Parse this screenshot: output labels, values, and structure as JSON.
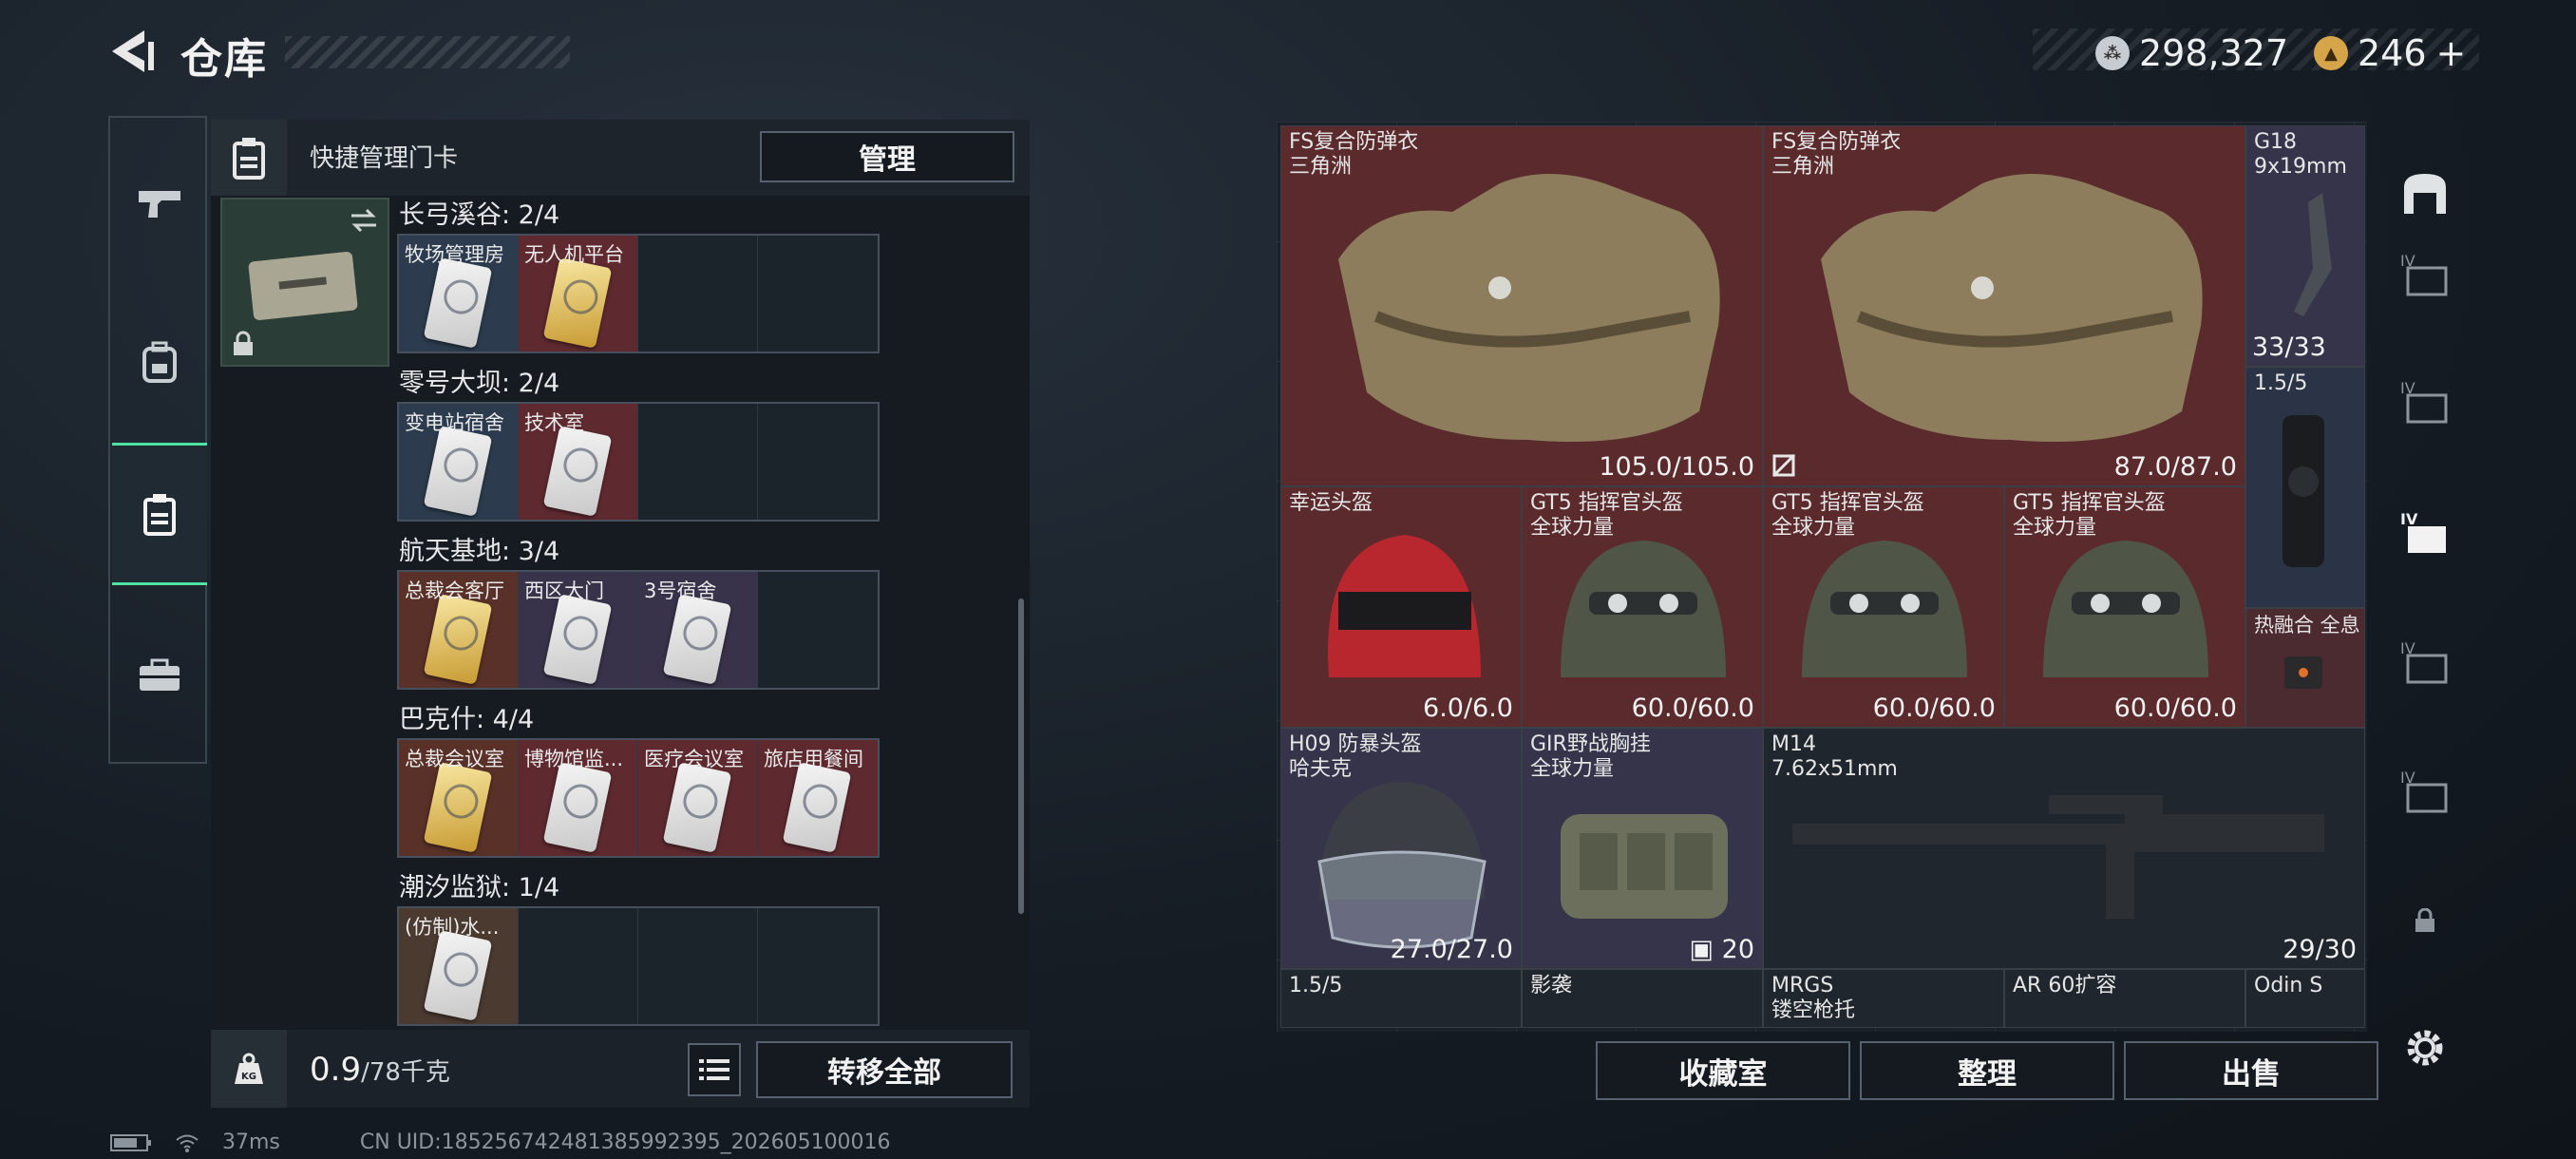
{
  "header": {
    "title": "仓库",
    "currency": [
      {
        "icon": "silver-coin-icon",
        "value": "298,327"
      },
      {
        "icon": "gold-coin-icon",
        "value": "246",
        "suffix": "+"
      }
    ]
  },
  "left_panel": {
    "title": "快捷管理门卡",
    "manage_label": "管理",
    "groups": [
      {
        "title": "长弓溪谷: 2/4",
        "slots": [
          {
            "label": "牧场管理房",
            "color": "blue",
            "card": "silver"
          },
          {
            "label": "无人机平台",
            "color": "red",
            "card": "gold"
          },
          {
            "label": "",
            "color": "",
            "card": ""
          },
          {
            "label": "",
            "color": "",
            "card": ""
          }
        ]
      },
      {
        "title": "零号大坝: 2/4",
        "slots": [
          {
            "label": "变电站宿舍",
            "color": "blue",
            "card": "silver"
          },
          {
            "label": "技术室",
            "color": "red",
            "card": "silver"
          },
          {
            "label": "",
            "color": "",
            "card": ""
          },
          {
            "label": "",
            "color": "",
            "card": ""
          }
        ]
      },
      {
        "title": "航天基地: 3/4",
        "slots": [
          {
            "label": "总裁会客厅",
            "color": "gold",
            "card": "gold"
          },
          {
            "label": "西区大门",
            "color": "purple",
            "card": "silver"
          },
          {
            "label": "3号宿舍",
            "color": "purple",
            "card": "silver"
          },
          {
            "label": "",
            "color": "",
            "card": ""
          }
        ]
      },
      {
        "title": "巴克什: 4/4",
        "slots": [
          {
            "label": "总裁会议室",
            "color": "gold",
            "card": "gold"
          },
          {
            "label": "博物馆监...",
            "color": "red",
            "card": "silver"
          },
          {
            "label": "医疗会议室",
            "color": "red",
            "card": "silver"
          },
          {
            "label": "旅店用餐间",
            "color": "red",
            "card": "silver"
          }
        ]
      },
      {
        "title": "潮汐监狱: 1/4",
        "slots": [
          {
            "label": "(仿制)水...",
            "color": "brown",
            "card": "silver"
          },
          {
            "label": "",
            "color": "",
            "card": ""
          },
          {
            "label": "",
            "color": "",
            "card": ""
          },
          {
            "label": "",
            "color": "",
            "card": ""
          }
        ]
      }
    ],
    "weight": "0.9",
    "weight_max": "/78千克",
    "transfer_label": "转移全部"
  },
  "inventory": {
    "items": [
      {
        "name": "FS复合防弹衣",
        "sub": "三角洲",
        "value": "105.0/105.0"
      },
      {
        "name": "FS复合防弹衣",
        "sub": "三角洲",
        "value": "87.0/87.0"
      },
      {
        "name": "G18",
        "sub": "9x19mm",
        "value": "33/33"
      },
      {
        "name": "",
        "sub": "1.5/5",
        "value": ""
      },
      {
        "name": "幸运头盔",
        "sub": "",
        "value": "6.0/6.0"
      },
      {
        "name": "GT5 指挥官头盔",
        "sub": "全球力量",
        "value": "60.0/60.0"
      },
      {
        "name": "GT5 指挥官头盔",
        "sub": "全球力量",
        "value": "60.0/60.0"
      },
      {
        "name": "GT5 指挥官头盔",
        "sub": "全球力量",
        "value": "60.0/60.0"
      },
      {
        "name": "热融合 全息",
        "sub": "",
        "value": ""
      },
      {
        "name": "H09 防暴头盔",
        "sub": "哈夫克",
        "value": "27.0/27.0"
      },
      {
        "name": "GIR野战胸挂",
        "sub": "全球力量",
        "value": "20"
      },
      {
        "name": "M14",
        "sub": "7.62x51mm",
        "value": "29/30"
      },
      {
        "name": "1.5/5",
        "sub": "",
        "value": ""
      },
      {
        "name": "影袭",
        "sub": "",
        "value": ""
      },
      {
        "name": "MRGS",
        "sub": "镂空枪托",
        "value": ""
      },
      {
        "name": "AR 60扩容",
        "sub": "",
        "value": ""
      },
      {
        "name": "Odin S",
        "sub": "",
        "value": ""
      }
    ],
    "buttons": {
      "collection": "收藏室",
      "sort": "整理",
      "sell": "出售"
    }
  },
  "status": {
    "ping": "37ms",
    "uid": "CN UID:1852567424813859923​95_202605100016"
  }
}
